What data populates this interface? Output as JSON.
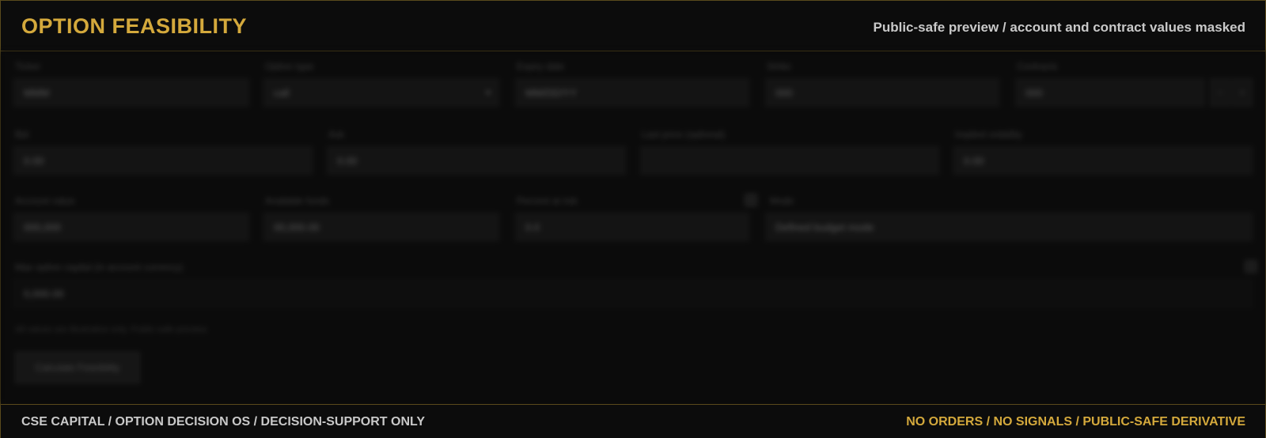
{
  "header": {
    "title": "OPTION FEASIBILITY",
    "subtitle": "Public-safe preview / account and contract values masked"
  },
  "form": {
    "row1": {
      "ticker": {
        "label": "Ticker",
        "value": "MMM"
      },
      "option_type": {
        "label": "Option type",
        "value": "call"
      },
      "expiry": {
        "label": "Expiry date",
        "value": "MM/DD/YY"
      },
      "strike": {
        "label": "Strike",
        "value": "000"
      },
      "contracts": {
        "label": "Contracts",
        "value": "000"
      }
    },
    "row2": {
      "bid": {
        "label": "Bid",
        "value": "0.00"
      },
      "ask": {
        "label": "Ask",
        "value": "0.00"
      },
      "last": {
        "label": "Last price (optional)",
        "value": ""
      },
      "iv": {
        "label": "Implied volatility",
        "value": "0.00"
      }
    },
    "row3": {
      "account_value": {
        "label": "Account value",
        "value": "000,000"
      },
      "available_funds": {
        "label": "Available funds",
        "value": "00,000.00"
      },
      "risk_pct": {
        "label": "Percent at risk",
        "value": "0.0"
      },
      "mode": {
        "label": "Mode",
        "value": "Defined budget mode"
      }
    },
    "row4": {
      "max_capital": {
        "label": "Max option capital (in account currency)",
        "value": "0,000.00"
      }
    },
    "hint": "All values are illustrative only. Public-safe preview.",
    "calc_button": "Calculate Feasibility"
  },
  "footer": {
    "left": "CSE CAPITAL / OPTION DECISION OS / DECISION-SUPPORT ONLY",
    "right": "NO ORDERS / NO SIGNALS / PUBLIC-SAFE DERIVATIVE"
  },
  "colors": {
    "accent": "#d4a93c",
    "border": "#5a4a1c",
    "background": "#0b0b0b"
  }
}
